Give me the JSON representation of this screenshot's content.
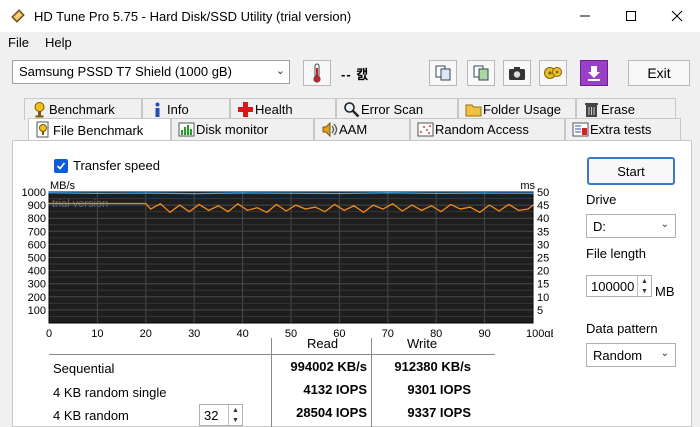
{
  "window": {
    "title": "HD Tune Pro 5.75 - Hard Disk/SSD Utility (trial version)",
    "minimize": "—",
    "maximize": "☐",
    "close": "✕"
  },
  "menu": [
    {
      "label": "File"
    },
    {
      "label": "Help"
    }
  ],
  "toolbar": {
    "drive": "Samsung PSSD T7 Shield (1000 gB)",
    "temperature": "-- 캜",
    "exit_label": "Exit"
  },
  "tabs_row1": [
    {
      "label": "Benchmark",
      "icon": "benchmark-icon"
    },
    {
      "label": "Info",
      "icon": "info-icon"
    },
    {
      "label": "Health",
      "icon": "health-icon"
    },
    {
      "label": "Error Scan",
      "icon": "error-scan-icon"
    },
    {
      "label": "Folder Usage",
      "icon": "folder-icon"
    },
    {
      "label": "Erase",
      "icon": "erase-icon"
    }
  ],
  "tabs_row2": [
    {
      "label": "File Benchmark",
      "icon": "file-benchmark-icon",
      "active": true
    },
    {
      "label": "Disk monitor",
      "icon": "disk-monitor-icon"
    },
    {
      "label": "AAM",
      "icon": "speaker-icon"
    },
    {
      "label": "Random Access",
      "icon": "random-access-icon"
    },
    {
      "label": "Extra tests",
      "icon": "extra-tests-icon"
    }
  ],
  "panel": {
    "transfer_speed_label": "Transfer speed",
    "transfer_speed_checked": true
  },
  "chart_data": {
    "type": "line",
    "watermark": "trial version",
    "left_unit": "MB/s",
    "right_unit": "ms",
    "x_unit": "gB",
    "y_left_ticks": [
      "1000",
      "900",
      "800",
      "700",
      "600",
      "500",
      "400",
      "300",
      "200",
      "100"
    ],
    "y_right_ticks": [
      "50",
      "45",
      "40",
      "35",
      "30",
      "25",
      "20",
      "15",
      "10",
      "5"
    ],
    "x_ticks": [
      "0",
      "10",
      "20",
      "30",
      "40",
      "50",
      "60",
      "70",
      "80",
      "90",
      "100gB"
    ],
    "ylim": [
      0,
      1000
    ],
    "xlim": [
      0,
      100
    ],
    "series": [
      {
        "name": "Read",
        "color": "#3fa9f5",
        "x": [
          0,
          10,
          20,
          30,
          40,
          50,
          60,
          70,
          80,
          90,
          100
        ],
        "values": [
          994,
          990,
          992,
          988,
          993,
          991,
          989,
          994,
          990,
          992,
          991
        ]
      },
      {
        "name": "Write",
        "color": "#f08a1c",
        "x": [
          0,
          10,
          20,
          21,
          23,
          25,
          27,
          29,
          31,
          33,
          35,
          37,
          39,
          41,
          43,
          45,
          47,
          49,
          51,
          53,
          55,
          57,
          59,
          61,
          63,
          65,
          67,
          69,
          71,
          73,
          75,
          77,
          79,
          81,
          83,
          85,
          87,
          89,
          91,
          93,
          95,
          97,
          99,
          100
        ],
        "values": [
          912,
          912,
          912,
          870,
          910,
          845,
          900,
          850,
          905,
          860,
          895,
          850,
          910,
          860,
          880,
          845,
          905,
          855,
          900,
          870,
          885,
          850,
          905,
          860,
          895,
          845,
          900,
          870,
          910,
          855,
          900,
          860,
          895,
          850,
          905,
          870,
          885,
          845,
          900,
          855,
          905,
          860,
          870,
          900
        ]
      }
    ]
  },
  "results": {
    "read_header": "Read",
    "write_header": "Write",
    "rows": [
      {
        "label": "Sequential",
        "read": "994002 KB/s",
        "write": "912380 KB/s"
      },
      {
        "label": "4 KB random single",
        "read": "4132 IOPS",
        "write": "9301 IOPS"
      },
      {
        "label": "4 KB random",
        "read": "28504 IOPS",
        "write": "9337 IOPS"
      }
    ],
    "queue_depth": "32"
  },
  "side": {
    "start_label": "Start",
    "drive_label": "Drive",
    "drive_value": "D:",
    "file_length_label": "File length",
    "file_length_value": "100000",
    "file_length_unit": "MB",
    "data_pattern_label": "Data pattern",
    "data_pattern_value": "Random"
  }
}
